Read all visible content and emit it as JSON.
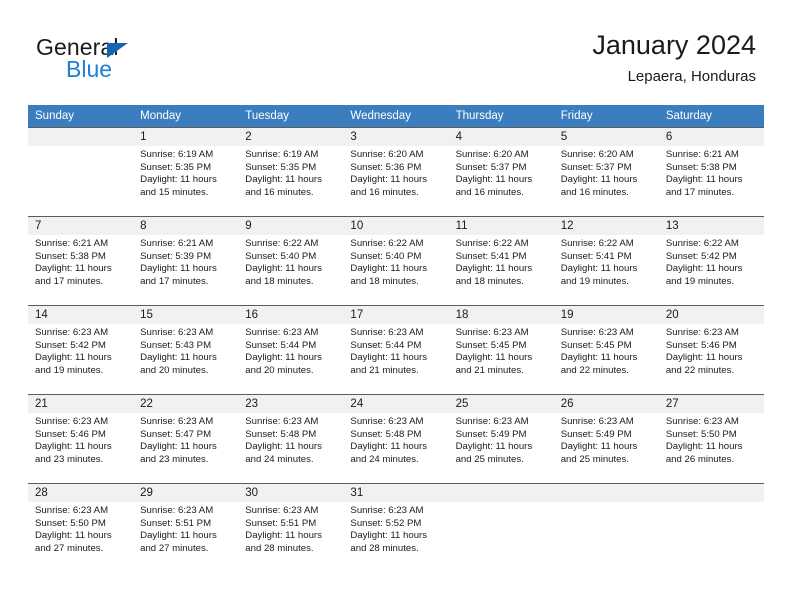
{
  "brand": {
    "word_top": "General",
    "word_bottom": "Blue",
    "triangle_color": "#1464b4",
    "blue_color": "#1e7fd4"
  },
  "header": {
    "title": "January 2024",
    "subtitle": "Lepaera, Honduras"
  },
  "theme": {
    "header_blue": "#3b7ebf",
    "daynum_band": "#f1f1f1",
    "grid_line": "#5c5c5c",
    "text": "#1b1b1b"
  },
  "weekday_headers": [
    "Sunday",
    "Monday",
    "Tuesday",
    "Wednesday",
    "Thursday",
    "Friday",
    "Saturday"
  ],
  "labels": {
    "sunrise_prefix": "Sunrise:",
    "sunset_prefix": "Sunset:",
    "daylight_prefix": "Daylight:"
  },
  "weeks": [
    [
      {
        "day": "",
        "sunrise": "",
        "sunset": "",
        "daylight": ""
      },
      {
        "day": "1",
        "sunrise": "Sunrise: 6:19 AM",
        "sunset": "Sunset: 5:35 PM",
        "daylight": "Daylight: 11 hours and 15 minutes."
      },
      {
        "day": "2",
        "sunrise": "Sunrise: 6:19 AM",
        "sunset": "Sunset: 5:35 PM",
        "daylight": "Daylight: 11 hours and 16 minutes."
      },
      {
        "day": "3",
        "sunrise": "Sunrise: 6:20 AM",
        "sunset": "Sunset: 5:36 PM",
        "daylight": "Daylight: 11 hours and 16 minutes."
      },
      {
        "day": "4",
        "sunrise": "Sunrise: 6:20 AM",
        "sunset": "Sunset: 5:37 PM",
        "daylight": "Daylight: 11 hours and 16 minutes."
      },
      {
        "day": "5",
        "sunrise": "Sunrise: 6:20 AM",
        "sunset": "Sunset: 5:37 PM",
        "daylight": "Daylight: 11 hours and 16 minutes."
      },
      {
        "day": "6",
        "sunrise": "Sunrise: 6:21 AM",
        "sunset": "Sunset: 5:38 PM",
        "daylight": "Daylight: 11 hours and 17 minutes."
      }
    ],
    [
      {
        "day": "7",
        "sunrise": "Sunrise: 6:21 AM",
        "sunset": "Sunset: 5:38 PM",
        "daylight": "Daylight: 11 hours and 17 minutes."
      },
      {
        "day": "8",
        "sunrise": "Sunrise: 6:21 AM",
        "sunset": "Sunset: 5:39 PM",
        "daylight": "Daylight: 11 hours and 17 minutes."
      },
      {
        "day": "9",
        "sunrise": "Sunrise: 6:22 AM",
        "sunset": "Sunset: 5:40 PM",
        "daylight": "Daylight: 11 hours and 18 minutes."
      },
      {
        "day": "10",
        "sunrise": "Sunrise: 6:22 AM",
        "sunset": "Sunset: 5:40 PM",
        "daylight": "Daylight: 11 hours and 18 minutes."
      },
      {
        "day": "11",
        "sunrise": "Sunrise: 6:22 AM",
        "sunset": "Sunset: 5:41 PM",
        "daylight": "Daylight: 11 hours and 18 minutes."
      },
      {
        "day": "12",
        "sunrise": "Sunrise: 6:22 AM",
        "sunset": "Sunset: 5:41 PM",
        "daylight": "Daylight: 11 hours and 19 minutes."
      },
      {
        "day": "13",
        "sunrise": "Sunrise: 6:22 AM",
        "sunset": "Sunset: 5:42 PM",
        "daylight": "Daylight: 11 hours and 19 minutes."
      }
    ],
    [
      {
        "day": "14",
        "sunrise": "Sunrise: 6:23 AM",
        "sunset": "Sunset: 5:42 PM",
        "daylight": "Daylight: 11 hours and 19 minutes."
      },
      {
        "day": "15",
        "sunrise": "Sunrise: 6:23 AM",
        "sunset": "Sunset: 5:43 PM",
        "daylight": "Daylight: 11 hours and 20 minutes."
      },
      {
        "day": "16",
        "sunrise": "Sunrise: 6:23 AM",
        "sunset": "Sunset: 5:44 PM",
        "daylight": "Daylight: 11 hours and 20 minutes."
      },
      {
        "day": "17",
        "sunrise": "Sunrise: 6:23 AM",
        "sunset": "Sunset: 5:44 PM",
        "daylight": "Daylight: 11 hours and 21 minutes."
      },
      {
        "day": "18",
        "sunrise": "Sunrise: 6:23 AM",
        "sunset": "Sunset: 5:45 PM",
        "daylight": "Daylight: 11 hours and 21 minutes."
      },
      {
        "day": "19",
        "sunrise": "Sunrise: 6:23 AM",
        "sunset": "Sunset: 5:45 PM",
        "daylight": "Daylight: 11 hours and 22 minutes."
      },
      {
        "day": "20",
        "sunrise": "Sunrise: 6:23 AM",
        "sunset": "Sunset: 5:46 PM",
        "daylight": "Daylight: 11 hours and 22 minutes."
      }
    ],
    [
      {
        "day": "21",
        "sunrise": "Sunrise: 6:23 AM",
        "sunset": "Sunset: 5:46 PM",
        "daylight": "Daylight: 11 hours and 23 minutes."
      },
      {
        "day": "22",
        "sunrise": "Sunrise: 6:23 AM",
        "sunset": "Sunset: 5:47 PM",
        "daylight": "Daylight: 11 hours and 23 minutes."
      },
      {
        "day": "23",
        "sunrise": "Sunrise: 6:23 AM",
        "sunset": "Sunset: 5:48 PM",
        "daylight": "Daylight: 11 hours and 24 minutes."
      },
      {
        "day": "24",
        "sunrise": "Sunrise: 6:23 AM",
        "sunset": "Sunset: 5:48 PM",
        "daylight": "Daylight: 11 hours and 24 minutes."
      },
      {
        "day": "25",
        "sunrise": "Sunrise: 6:23 AM",
        "sunset": "Sunset: 5:49 PM",
        "daylight": "Daylight: 11 hours and 25 minutes."
      },
      {
        "day": "26",
        "sunrise": "Sunrise: 6:23 AM",
        "sunset": "Sunset: 5:49 PM",
        "daylight": "Daylight: 11 hours and 25 minutes."
      },
      {
        "day": "27",
        "sunrise": "Sunrise: 6:23 AM",
        "sunset": "Sunset: 5:50 PM",
        "daylight": "Daylight: 11 hours and 26 minutes."
      }
    ],
    [
      {
        "day": "28",
        "sunrise": "Sunrise: 6:23 AM",
        "sunset": "Sunset: 5:50 PM",
        "daylight": "Daylight: 11 hours and 27 minutes."
      },
      {
        "day": "29",
        "sunrise": "Sunrise: 6:23 AM",
        "sunset": "Sunset: 5:51 PM",
        "daylight": "Daylight: 11 hours and 27 minutes."
      },
      {
        "day": "30",
        "sunrise": "Sunrise: 6:23 AM",
        "sunset": "Sunset: 5:51 PM",
        "daylight": "Daylight: 11 hours and 28 minutes."
      },
      {
        "day": "31",
        "sunrise": "Sunrise: 6:23 AM",
        "sunset": "Sunset: 5:52 PM",
        "daylight": "Daylight: 11 hours and 28 minutes."
      },
      {
        "day": "",
        "sunrise": "",
        "sunset": "",
        "daylight": ""
      },
      {
        "day": "",
        "sunrise": "",
        "sunset": "",
        "daylight": ""
      },
      {
        "day": "",
        "sunrise": "",
        "sunset": "",
        "daylight": ""
      }
    ]
  ]
}
